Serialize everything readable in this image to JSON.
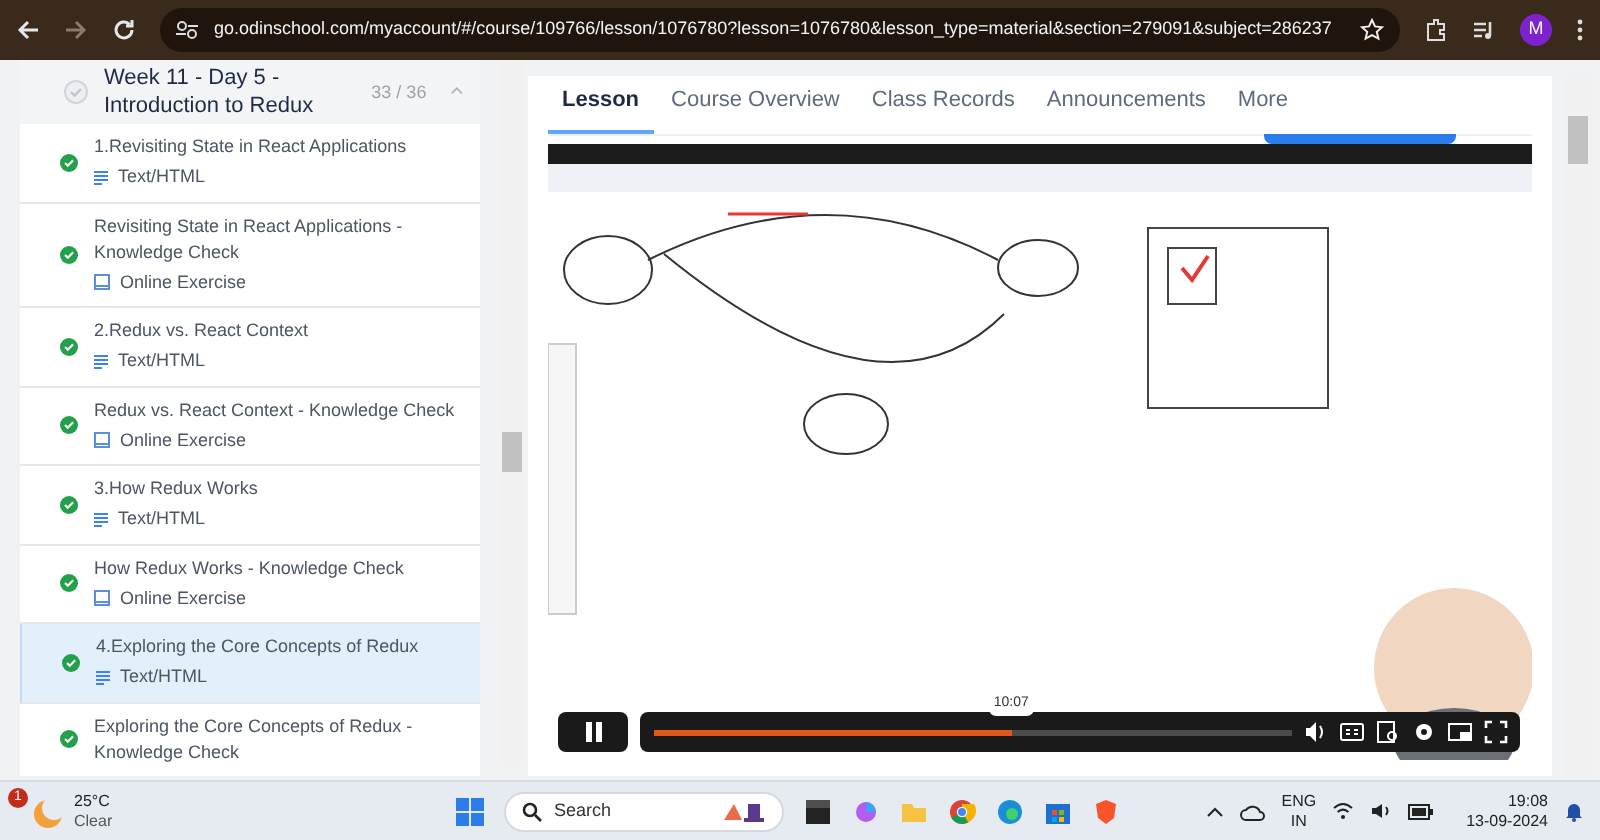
{
  "browser": {
    "url": "go.odinschool.com/myaccount/#/course/109766/lesson/1076780?lesson=1076780&lesson_type=material&section=279091&subject=286237",
    "avatar": "M"
  },
  "section": {
    "title": "Week 11 - Day 5 - Introduction to Redux",
    "count": "33 / 36",
    "completed": false,
    "expanded": true
  },
  "lessons": [
    {
      "title": "1.Revisiting State in React Applications",
      "type_label": "Text/HTML",
      "kind": "text",
      "completed": true,
      "selected": false
    },
    {
      "title": "Revisiting State in React Applications - Knowledge Check",
      "type_label": "Online Exercise",
      "kind": "exercise",
      "completed": true,
      "selected": false
    },
    {
      "title": "2.Redux vs. React Context",
      "type_label": "Text/HTML",
      "kind": "text",
      "completed": true,
      "selected": false
    },
    {
      "title": "Redux vs. React Context - Knowledge Check",
      "type_label": "Online Exercise",
      "kind": "exercise",
      "completed": true,
      "selected": false
    },
    {
      "title": "3.How Redux Works",
      "type_label": "Text/HTML",
      "kind": "text",
      "completed": true,
      "selected": false
    },
    {
      "title": "How Redux Works - Knowledge Check",
      "type_label": "Online Exercise",
      "kind": "exercise",
      "completed": true,
      "selected": false
    },
    {
      "title": "4.Exploring the Core Concepts of Redux",
      "type_label": "Text/HTML",
      "kind": "text",
      "completed": true,
      "selected": true
    },
    {
      "title": "Exploring the Core Concepts of Redux - Knowledge Check",
      "completed": true,
      "selected": false
    }
  ],
  "tabs": [
    {
      "label": "Lesson",
      "selected": true
    },
    {
      "label": "Course Overview",
      "selected": false
    },
    {
      "label": "Class Records",
      "selected": false
    },
    {
      "label": "Announcements",
      "selected": false
    },
    {
      "label": "More",
      "selected": false
    }
  ],
  "video": {
    "kind": "picture",
    "playing": true,
    "time": "10:07",
    "level": 0.56
  },
  "taskbar": {
    "temperature": "25°C",
    "weather": "Clear",
    "badge": "1",
    "search_placeholder": "Search",
    "language": "ENG",
    "region": "IN",
    "time": "19:08",
    "date": "13-09-2024"
  }
}
